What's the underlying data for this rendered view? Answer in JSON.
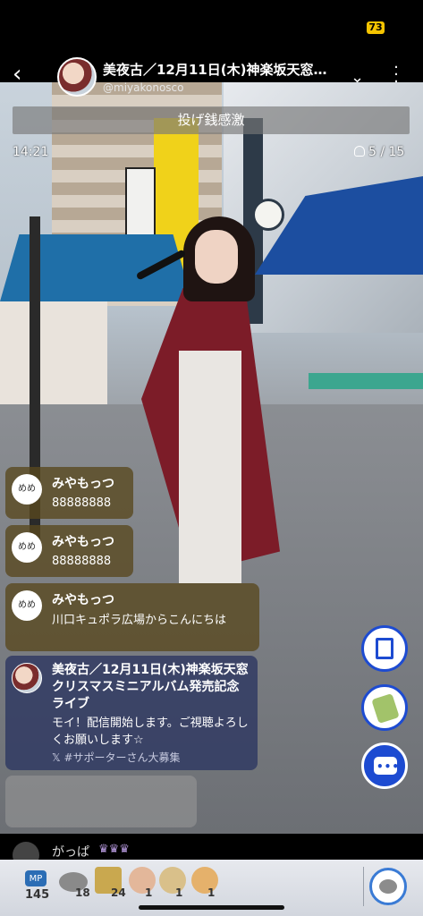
{
  "status_bar": {
    "battery": "73"
  },
  "header": {
    "title": "美夜古／12月11日(木)神楽坂天窓…",
    "handle": "@miyakonosco"
  },
  "announcement": "投げ銭感激",
  "stream": {
    "time": "14:21",
    "viewers": "5 / 15"
  },
  "comments": [
    {
      "avatar_text": "めめ",
      "name": "みやもっつ",
      "text": "88888888"
    },
    {
      "avatar_text": "めめ",
      "name": "みやもっつ",
      "text": "88888888"
    },
    {
      "avatar_text": "めめ",
      "name": "みやもっつ",
      "text": "川口キュポラ広場からこんにちは"
    }
  ],
  "broadcast": {
    "title": "美夜古／12月11日(木)神楽坂天窓クリスマスミニアルバム発売記念ライブ",
    "message": "モイ！配信開始します。ご視聴よろしくお願いします☆",
    "sub": "𝕏 #サポーターさん大募集"
  },
  "viewer_row": {
    "name": "がっぱ",
    "crowns": "♛♛♛"
  },
  "toolbar": {
    "mp_label": "MP",
    "mp_count": "145",
    "items": [
      {
        "icon": "coin-icon",
        "count": "18"
      },
      {
        "icon": "p-points-icon",
        "count": "24"
      },
      {
        "icon": "clap-icon",
        "count": "1"
      },
      {
        "icon": "seed-icon",
        "count": "1"
      },
      {
        "icon": "seed-alt-icon",
        "count": "1"
      }
    ]
  },
  "icons": {
    "back": "back-arrow-icon",
    "chevron": "chevron-down-icon",
    "more": "more-vertical-icon",
    "viewers": "person-icon",
    "screenshot": "screenshot-icon",
    "gift": "gift-icon",
    "comment": "comment-icon",
    "throw_coin": "coin-throw-icon"
  },
  "colors": {
    "accent": "#1d4bd1",
    "battery": "#f5c400",
    "comment_bg": "#58481e",
    "broadcast_bg": "#2e3862"
  }
}
